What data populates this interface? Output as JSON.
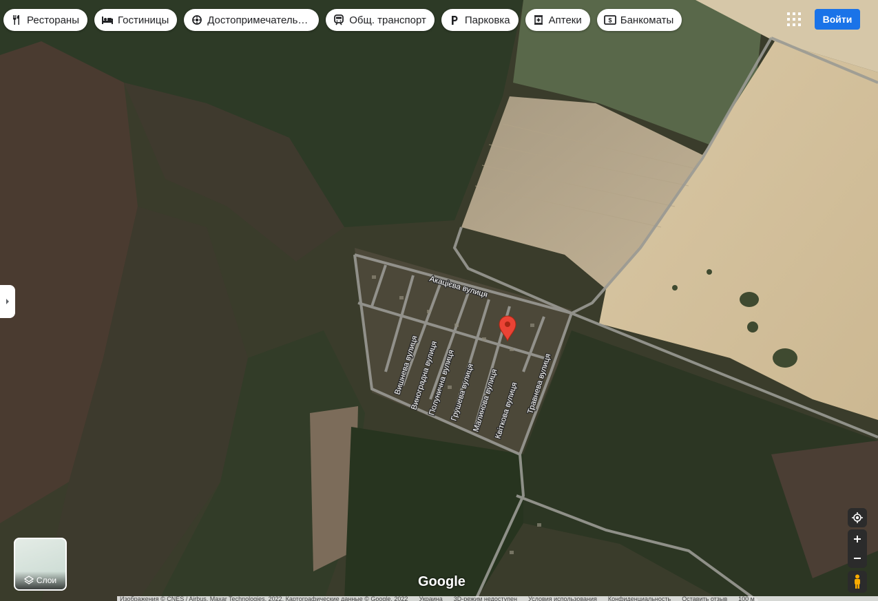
{
  "toolbar": {
    "chips": [
      {
        "label": "Рестораны",
        "icon": "fork-knife-icon"
      },
      {
        "label": "Гостиницы",
        "icon": "bed-icon"
      },
      {
        "label": "Достопримечательн...",
        "icon": "landmark-icon"
      },
      {
        "label": "Общ. транспорт",
        "icon": "train-icon"
      },
      {
        "label": "Парковка",
        "icon": "parking-icon"
      },
      {
        "label": "Аптеки",
        "icon": "pharmacy-icon"
      },
      {
        "label": "Банкоматы",
        "icon": "atm-icon"
      }
    ],
    "signin_label": "Войти"
  },
  "map": {
    "streets": [
      "Акацієва вулиця",
      "Вишнева вулиця",
      "Виноградна вулиця",
      "Полунична вулиця",
      "Грушева вулиця",
      "Малинова вулиця",
      "Квіткова вулиця",
      "Травнева вулиця"
    ],
    "marker_icon": "map-pin-icon",
    "marker_color": "#ea4335"
  },
  "layers": {
    "label": "Слои"
  },
  "logo": "Google",
  "footer": {
    "items": [
      "Изображения © CNES / Airbus, Maxar Technologies, 2022, Картографические данные © Google, 2022",
      "Украина",
      "3D-режим недоступен",
      "Условия использования",
      "Конфиденциальность",
      "Оставить отзыв",
      "100 м"
    ]
  }
}
